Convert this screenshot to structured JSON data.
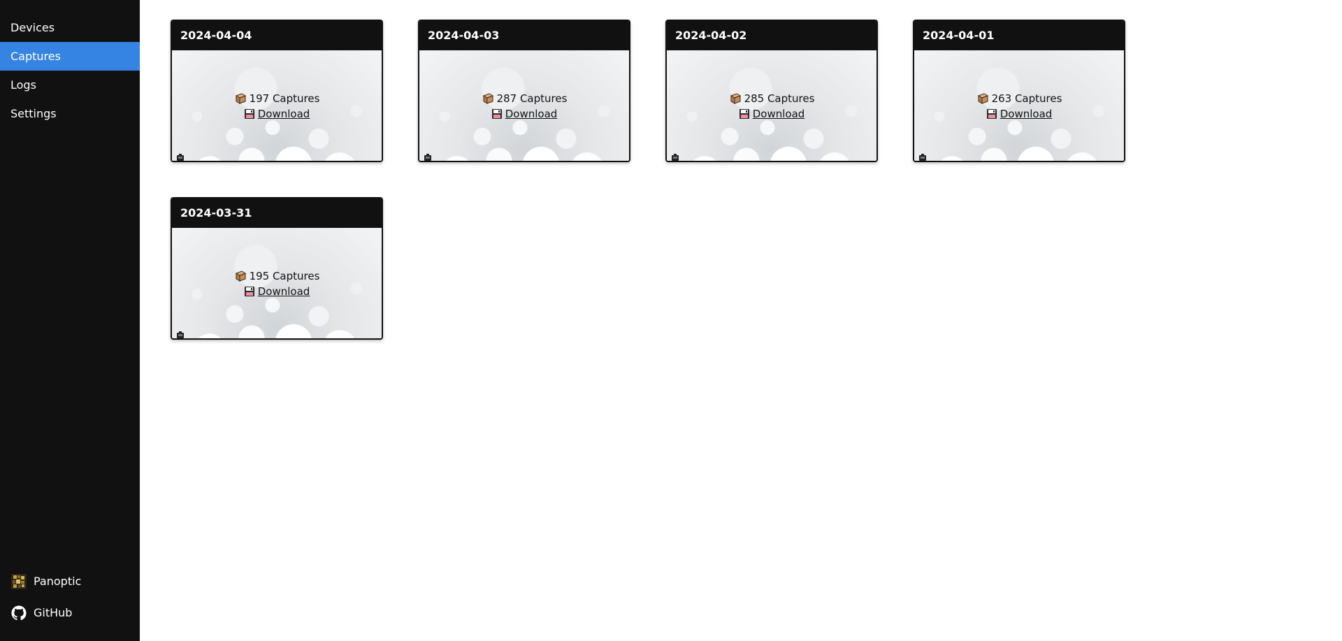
{
  "sidebar": {
    "nav": [
      {
        "label": "Devices",
        "active": false
      },
      {
        "label": "Captures",
        "active": true
      },
      {
        "label": "Logs",
        "active": false
      },
      {
        "label": "Settings",
        "active": false
      }
    ],
    "footer": [
      {
        "label": "Panoptic",
        "icon": "panoptic-logo-icon"
      },
      {
        "label": "GitHub",
        "icon": "github-icon"
      }
    ]
  },
  "captures": [
    {
      "date": "2024-04-04",
      "count": "197 Captures",
      "download": "Download"
    },
    {
      "date": "2024-04-03",
      "count": "287 Captures",
      "download": "Download"
    },
    {
      "date": "2024-04-02",
      "count": "285 Captures",
      "download": "Download"
    },
    {
      "date": "2024-04-01",
      "count": "263 Captures",
      "download": "Download"
    },
    {
      "date": "2024-03-31",
      "count": "195 Captures",
      "download": "Download"
    }
  ],
  "colors": {
    "sidebar_bg": "#111111",
    "active_accent": "#3584e4"
  }
}
